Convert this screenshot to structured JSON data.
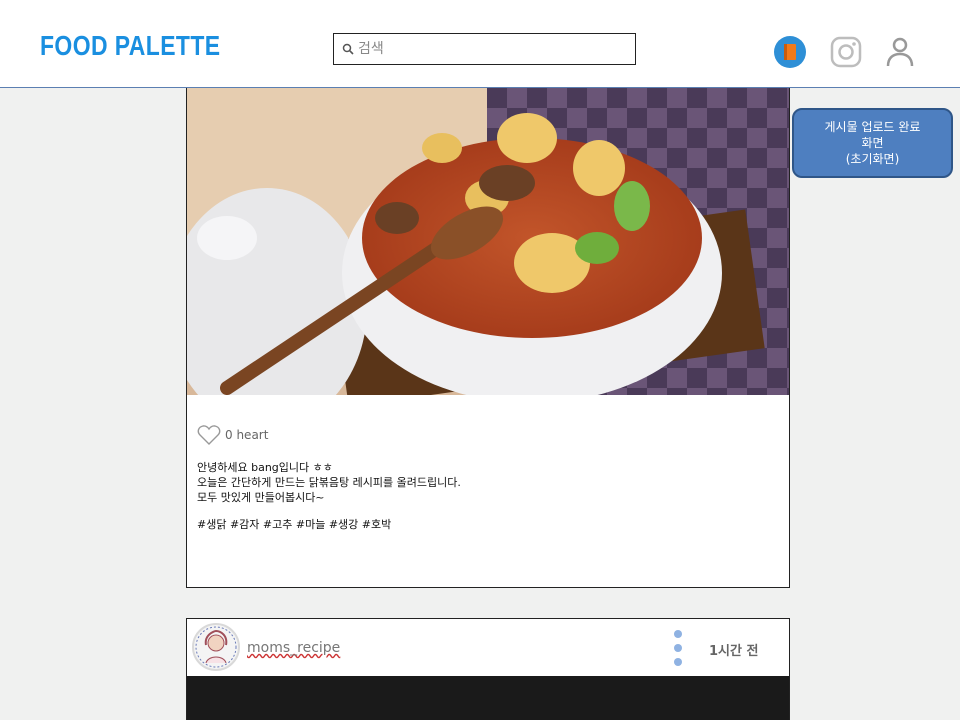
{
  "header": {
    "logo": "FOOD PALETTE",
    "search_placeholder": "검색"
  },
  "icons": {
    "search": "search-icon",
    "book": "book-icon",
    "instagram": "instagram-icon",
    "user": "user-icon",
    "heart": "heart-icon",
    "menu": "more-vert-icon"
  },
  "post1": {
    "likes": "0 heart",
    "caption": [
      "안녕하세요 bang입니다 ㅎㅎ",
      "오늘은 간단하게 만드는 닭볶음탕 레시피를 올려드립니다.",
      "모두 맛있게 만들어봅시다~"
    ],
    "tags": "#생닭 #감자 #고추 #마늘 #생강 #호박"
  },
  "post2": {
    "username": "moms_recipe",
    "time": "1시간 전"
  },
  "note": {
    "line1": "게시물 업로드 완료",
    "line2": "화면",
    "line3": "(초기화면)"
  },
  "colors": {
    "accent": "#1a8fe0",
    "note_bg": "#4e7fc0",
    "background": "#f0f1f0"
  }
}
